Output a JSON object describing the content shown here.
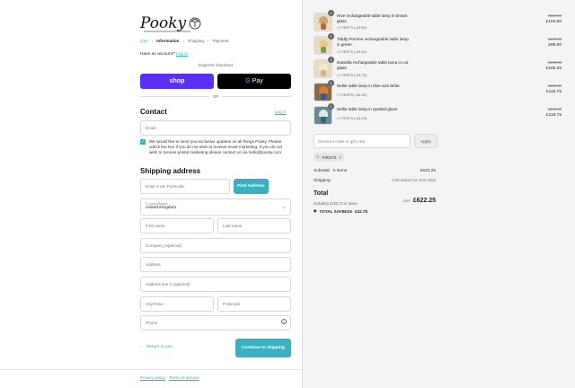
{
  "brand": {
    "logo_text": "Pooky"
  },
  "breadcrumb": [
    "Cart",
    "Information",
    "Shipping",
    "Payment"
  ],
  "account": {
    "prompt": "Have an account?",
    "link": "Log in"
  },
  "express": {
    "label": "Express checkout",
    "shop": "shop",
    "gpay": "Pay",
    "gpay_g": "G",
    "or": "OR"
  },
  "contact": {
    "title": "Contact",
    "login": "Log in",
    "email_placeholder": "Email",
    "consent": "We would like to send you exclusive updates on all things Pooky. Please untick the box if you do not wish to receive email marketing. If you do not wish to receive postal marketing please contact us via hello@pooky.com"
  },
  "shipping": {
    "title": "Shipping address",
    "postcode_lookup": "Enter a UK Postcode",
    "find": "Find Address",
    "country_label": "Country/Region",
    "country": "United Kingdom",
    "first": "First name",
    "last": "Last name",
    "company": "Company (optional)",
    "address": "Address",
    "address2": "Address line 2 (optional)",
    "city": "City/Town",
    "postcode": "Postcode",
    "phone": "Phone"
  },
  "actions": {
    "return": "Return to cart",
    "continue": "Continue to shipping"
  },
  "footer": {
    "privacy": "Privacy policy",
    "terms": "Terms of service"
  },
  "cart": {
    "items": [
      {
        "qty": "1",
        "name": "Hive rechargeable table lamp in brown glass",
        "discount": "FIRST5 (-£5.50)",
        "old": "£110.00",
        "new": "£104.50"
      },
      {
        "qty": "1",
        "name": "Tiddly Pomme rechargeable table lamp in green",
        "discount": "FIRST5 (-£5.00)",
        "old": "£100.00",
        "new": "£95.00"
      },
      {
        "qty": "1",
        "name": "Daniella rechargeable table lamp in cut glass",
        "discount": "FIRST5 (-£9.75)",
        "old": "£195.00",
        "new": "£185.25"
      },
      {
        "qty": "1",
        "name": "Nellie table lamp in blue and white",
        "discount": "FIRST5 (-£6.25)",
        "old": "£125.00",
        "new": "£118.75"
      },
      {
        "qty": "1",
        "name": "Nellie table lamp in spotted glaze",
        "discount": "FIRST5 (-£6.25)",
        "old": "£125.00",
        "new": "£118.75"
      }
    ],
    "code_placeholder": "Discount code or gift card",
    "apply": "Apply",
    "applied_code": "FIRST5",
    "subtotal_label": "Subtotal · 5 items",
    "subtotal": "£622.25",
    "shipping_label": "Shipping",
    "shipping": "Calculated at next step",
    "total_label": "Total",
    "currency": "GBP",
    "total": "£622.25",
    "taxes": "Including £103.71 in taxes",
    "savings_label": "TOTAL SAVINGS",
    "savings": "£32.75"
  },
  "colors": {
    "accent": "#2cb3c5",
    "shop": "#5a31f4",
    "button": "#3bb0c0"
  }
}
